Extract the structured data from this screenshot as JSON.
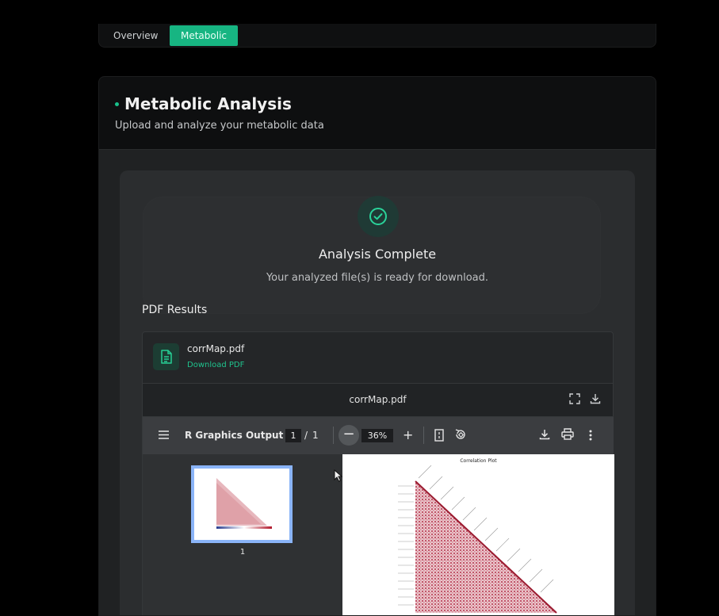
{
  "tabs": [
    {
      "label": "Overview",
      "active": false
    },
    {
      "label": "Metabolic",
      "active": true
    }
  ],
  "panel": {
    "title": "Metabolic Analysis",
    "subtitle": "Upload and analyze your metabolic data"
  },
  "status": {
    "icon": "check-circle-icon",
    "title": "Analysis Complete",
    "message": "Your analyzed file(s) is ready for download."
  },
  "results": {
    "section_label": "PDF Results",
    "file": {
      "icon": "document-icon",
      "name": "corrMap.pdf",
      "link": "Download PDF"
    },
    "viewer": {
      "file_name": "corrMap.pdf",
      "toolbar": {
        "doc_title": "R Graphics Output",
        "page_current": "1",
        "page_sep": "/",
        "page_total": "1",
        "zoom": "36%"
      },
      "thumbnail_page": "1",
      "page_heading": "Correlation Plot"
    }
  },
  "colors": {
    "accent": "#17b582",
    "panel_bg": "#202223",
    "card_bg": "#2b2d2f",
    "viewer_toolbar": "#3b3d40"
  }
}
